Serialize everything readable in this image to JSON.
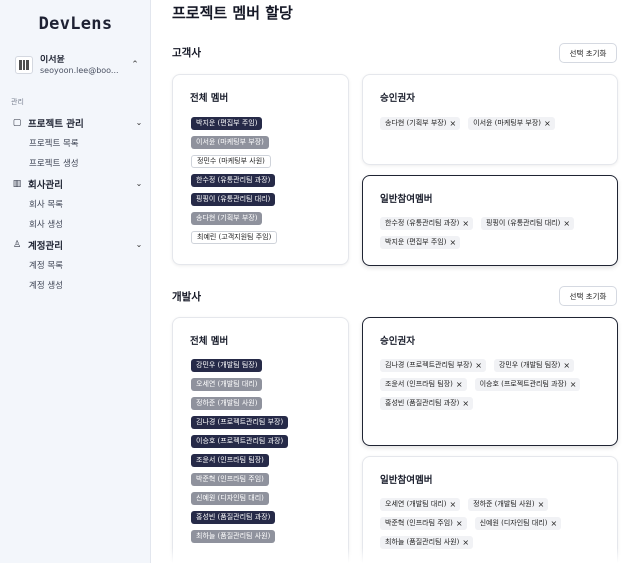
{
  "sidebar": {
    "brand": "DevLens",
    "user": {
      "name": "이서윤",
      "email": "seoyoon.lee@boo..."
    },
    "section_label": "관리",
    "groups": [
      {
        "label": "프로젝트 관리",
        "icon": "folder-icon",
        "items": [
          "프로젝트 목록",
          "프로젝트 생성"
        ]
      },
      {
        "label": "회사관리",
        "icon": "building-icon",
        "items": [
          "회사 목록",
          "회사 생성"
        ]
      },
      {
        "label": "계정관리",
        "icon": "person-icon",
        "items": [
          "계정 목록",
          "계정 생성"
        ]
      }
    ]
  },
  "main": {
    "title": "프로젝트 멤버 할당",
    "client": {
      "title": "고객사",
      "reset_label": "선택 초기화",
      "all_members": {
        "title": "전체 멤버",
        "members": [
          {
            "label": "박지운 (편집부 주임)",
            "state": "dark"
          },
          {
            "label": "이서윤 (마케팅부 부장)",
            "state": "gray"
          },
          {
            "label": "정민수 (마케팅부 사원)",
            "state": "outline"
          },
          {
            "label": "한수정 (유통관리팀 과장)",
            "state": "dark"
          },
          {
            "label": "핑핑이 (유통관리팀 대리)",
            "state": "dark"
          },
          {
            "label": "송다현 (기획부 부장)",
            "state": "gray"
          },
          {
            "label": "최예린 (고객지원팀 주임)",
            "state": "outline"
          }
        ]
      },
      "approvers": {
        "title": "승인권자",
        "tags": [
          "송다현 (기획부 부장)",
          "이서윤 (마케팅부 부장)"
        ]
      },
      "participants": {
        "title": "일반참여멤버",
        "tags": [
          "한수정 (유통관리팀 과장)",
          "핑핑이 (유통관리팀 대리)",
          "박지운 (편집부 주임)"
        ]
      }
    },
    "developer": {
      "title": "개발사",
      "reset_label": "선택 초기화",
      "all_members": {
        "title": "전체 멤버",
        "members": [
          {
            "label": "강민우 (개발팀 팀장)",
            "state": "dark"
          },
          {
            "label": "오세연 (개발팀 대리)",
            "state": "gray"
          },
          {
            "label": "정하준 (개발팀 사원)",
            "state": "gray"
          },
          {
            "label": "김나경 (프로젝트관리팀 부장)",
            "state": "dark"
          },
          {
            "label": "이승호 (프로젝트관리팀 과장)",
            "state": "dark"
          },
          {
            "label": "조윤서 (인프라팀 팀장)",
            "state": "dark"
          },
          {
            "label": "박준혁 (인프라팀 주임)",
            "state": "gray"
          },
          {
            "label": "신예원 (디자인팀 대리)",
            "state": "gray"
          },
          {
            "label": "홍성빈 (품질관리팀 과장)",
            "state": "dark"
          },
          {
            "label": "최하늘 (품질관리팀 사원)",
            "state": "gray"
          }
        ]
      },
      "approvers": {
        "title": "승인권자",
        "tags": [
          "김나경 (프로젝트관리팀 부장)",
          "강민우 (개발팀 팀장)",
          "조윤서 (인프라팀 팀장)",
          "이승호 (프로젝트관리팀 과장)",
          "홍성빈 (품질관리팀 과장)"
        ]
      },
      "participants": {
        "title": "일반참여멤버",
        "tags": [
          "오세연 (개발팀 대리)",
          "정하준 (개발팀 사원)",
          "박준혁 (인프라팀 주임)",
          "신예원 (디자인팀 대리)",
          "최하늘 (품질관리팀 사원)"
        ]
      }
    }
  },
  "icons": {
    "remove": "×",
    "chevron": "⌄"
  }
}
